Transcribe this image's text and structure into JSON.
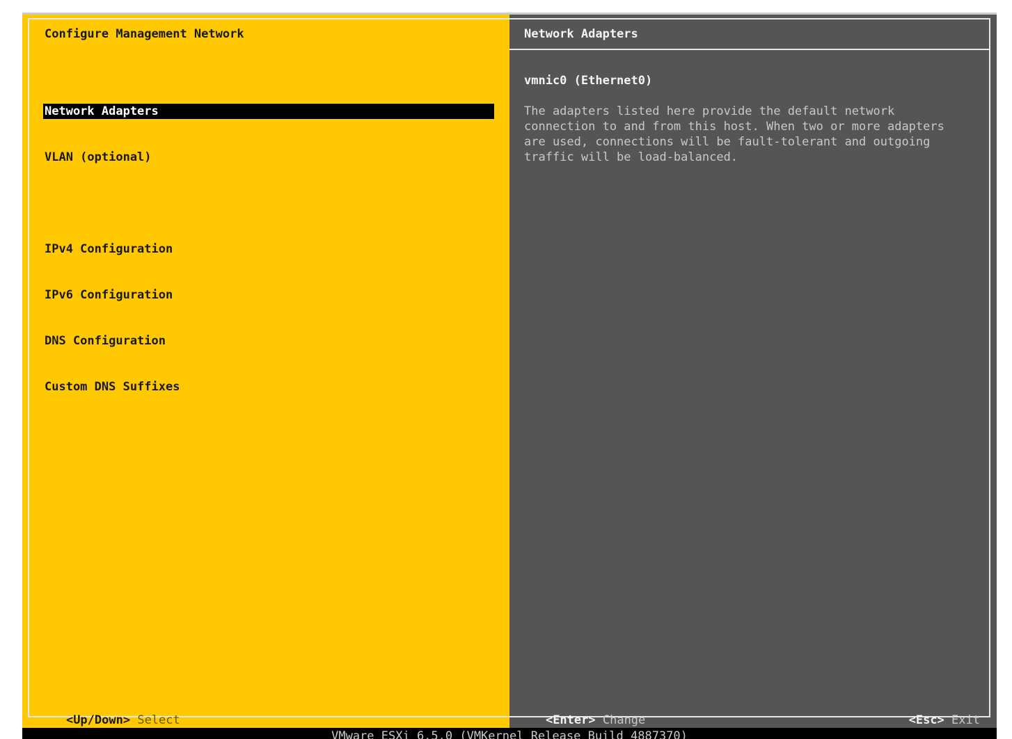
{
  "left_panel": {
    "title": "Configure Management Network",
    "menu_items": [
      {
        "label": "Network Adapters"
      },
      {
        "label": "VLAN (optional)"
      },
      {
        "label": "IPv4 Configuration"
      },
      {
        "label": "IPv6 Configuration"
      },
      {
        "label": "DNS Configuration"
      },
      {
        "label": "Custom DNS Suffixes"
      }
    ],
    "selected_item": "Network Adapters"
  },
  "right_panel": {
    "title": "Network Adapters",
    "adapter": "vmnic0 (Ethernet0)",
    "description": "The adapters listed here provide the default network\nconnection to and from this host. When two or more adapters\nare used, connections will be fault-tolerant and outgoing\ntraffic will be load-balanced."
  },
  "footer": {
    "nav_key": "<Up/Down>",
    "nav_action": "Select",
    "enter_key": "<Enter>",
    "enter_action": "Change",
    "esc_key": "<Esc>",
    "esc_action": "Exit"
  },
  "status_bar": {
    "text": "VMware ESXi 6.5.0 (VMKernel Release Build 4887370)"
  },
  "colors": {
    "left_background": "#ffc800",
    "right_background": "#555555",
    "selection_background": "#000000"
  }
}
